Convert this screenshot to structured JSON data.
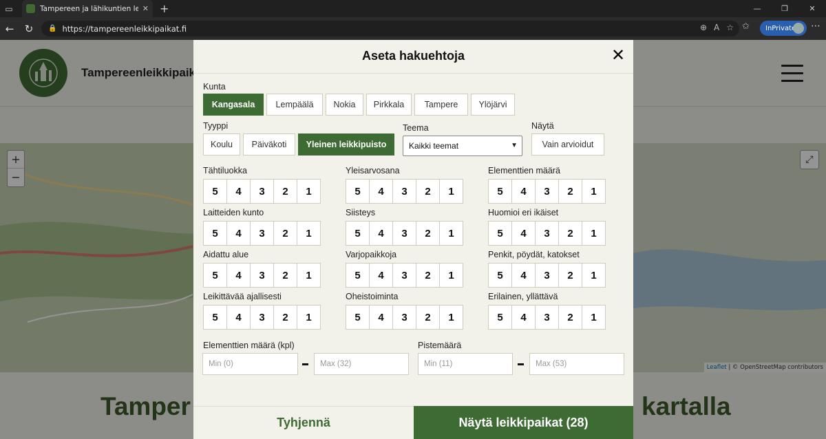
{
  "browser": {
    "tab_title": "Tampereen ja lähikuntien leikkipu",
    "url": "https://tampereenleikkipaikat.fi",
    "inprivate_label": "InPrivate"
  },
  "site": {
    "name": "Tampereenleikkipaik",
    "title_left": "Tamper",
    "title_right": "kartalla",
    "attribution_leaflet": "Leaflet",
    "attribution_rest": " | © OpenStreetMap contributors"
  },
  "modal": {
    "title": "Aseta hakuehtoja",
    "kunta_label": "Kunta",
    "kunta": [
      "Kangasala",
      "Lempäälä",
      "Nokia",
      "Pirkkala",
      "Tampere",
      "Ylöjärvi"
    ],
    "tyyppi_label": "Tyyppi",
    "tyyppi": [
      "Koulu",
      "Päiväkoti",
      "Yleinen leikkipuisto"
    ],
    "teema_label": "Teema",
    "teema_value": "Kaikki teemat",
    "nayta_label": "Näytä",
    "nayta_option": "Vain arvioidut",
    "ratings": [
      "Tähtiluokka",
      "Yleisarvosana",
      "Elementtien määrä",
      "Laitteiden kunto",
      "Siisteys",
      "Huomioi eri ikäiset",
      "Aidattu alue",
      "Varjopaikkoja",
      "Penkit, pöydät, katokset",
      "Leikittävää ajallisesti",
      "Oheistoiminta",
      "Erilainen, yllättävä"
    ],
    "rating_values": [
      "5",
      "4",
      "3",
      "2",
      "1"
    ],
    "elementit_label": "Elementtien määrä (kpl)",
    "elementit_min": "Min (0)",
    "elementit_max": "Max (32)",
    "pisteet_label": "Pistemäärä",
    "pisteet_min": "Min (11)",
    "pisteet_max": "Max (53)",
    "clear_label": "Tyhjennä",
    "show_label": "Näytä leikkipaikat  (28)"
  },
  "colors": {
    "accent": "#3e6b34",
    "background": "#f2f1ea"
  },
  "icons": [
    "close-icon",
    "hamburger-icon",
    "zoom-in-icon",
    "zoom-out-icon",
    "fullscreen-icon",
    "chevron-down-icon"
  ]
}
